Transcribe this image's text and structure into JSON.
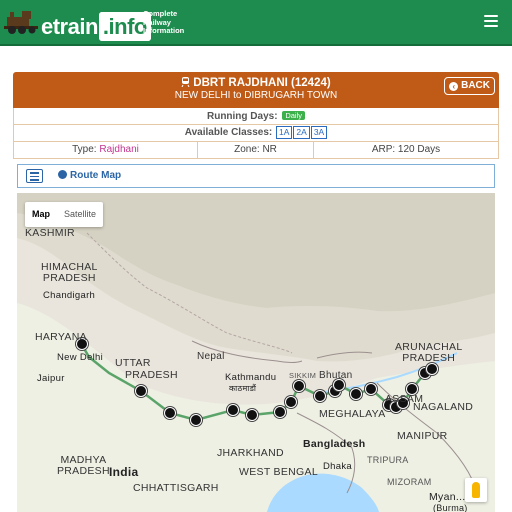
{
  "header": {
    "brand_main": "etrain",
    "brand_suffix": ".info",
    "tagline": "Complete Railway Information"
  },
  "train": {
    "name": "DBRT RAJDHANI (12424)",
    "route": "NEW DELHI to DIBRUGARH TOWN",
    "back_label": "BACK",
    "running_days_label": "Running Days:",
    "running_days_value": "Daily",
    "classes_label": "Available Classes:",
    "classes": [
      "1A",
      "2A",
      "3A"
    ],
    "type_label": "Type:",
    "type_value": "Rajdhani",
    "zone_text": "Zone: NR",
    "arp_text": "ARP: 120 Days"
  },
  "route_map_label": "Route Map",
  "map": {
    "tabs": [
      "Map",
      "Satellite"
    ],
    "active_tab": "Map",
    "labels": {
      "kashmir": "KASHMIR",
      "himachal": "HIMACHAL\nPRADESH",
      "chandigarh": "Chandigarh",
      "haryana": "HARYANA",
      "new_delhi": "New Delhi",
      "jaipur": "Jaipur",
      "uttar": "UTTAR",
      "pradesh_up": "PRADESH",
      "madhya": "MADHYA\nPRADESH",
      "india": "India",
      "jharkhand": "JHARKHAND",
      "chhattisgarh": "CHHATTISGARH",
      "west_bengal": "WEST BENGAL",
      "nepal": "Nepal",
      "kathmandu": "Kathmandu",
      "kathmandu_native": "काठमाडौं",
      "bhutan": "Bhutan",
      "sikkim": "SIKKIM",
      "assam": "ASSAM",
      "meghalaya": "MEGHALAYA",
      "bangladesh": "Bangladesh",
      "arunachal": "ARUNACHAL\nPRADESH",
      "nagaland": "NAGALAND",
      "manipur": "MANIPUR",
      "mizoram": "MIZORAM",
      "tripura": "TRIPURA",
      "myanmar": "Myan...",
      "burma": "(Burma)",
      "dhaka": "Dhaka"
    }
  },
  "colors": {
    "header_green": "#1e8c4e",
    "title_orange": "#bf5b17",
    "link_blue": "#2b65a5",
    "route_line": "#5aa469"
  },
  "icons": [
    "train-logo-icon",
    "menu-icon",
    "train-icon",
    "back-arrow-icon",
    "list-icon",
    "globe-icon",
    "station-marker-icon",
    "pegman-icon"
  ]
}
